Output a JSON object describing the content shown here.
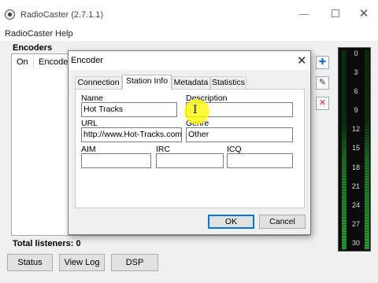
{
  "app": {
    "title": "RadioCaster (2.7.1.1)"
  },
  "window_controls": {
    "minimize": "—",
    "maximize": "",
    "close": "✕"
  },
  "menu": [
    "RadioCaster",
    "Help"
  ],
  "encoders": {
    "label": "Encoders",
    "columns": [
      "On",
      "Encoder"
    ],
    "total_listeners": "Total listeners: 0"
  },
  "side_icons": [
    "add-icon",
    "edit-icon",
    "delete-icon"
  ],
  "bottom_buttons": [
    "Status",
    "View Log",
    "DSP"
  ],
  "meter": {
    "scale": [
      "0",
      "3",
      "6",
      "9",
      "12",
      "15",
      "18",
      "21",
      "24",
      "27",
      "30"
    ],
    "colors": {
      "bright": "#2fc23b",
      "dim": "#0a3a12"
    }
  },
  "dialog": {
    "title": "Encoder",
    "close": "✕",
    "tabs": [
      "Connection",
      "Station Info",
      "Metadata",
      "Statistics"
    ],
    "active_tab": "Station Info",
    "fields": {
      "name": {
        "label": "Name",
        "value": "Hot Tracks"
      },
      "description": {
        "label": "Description",
        "value": ""
      },
      "url": {
        "label": "URL",
        "value": "http://www.Hot-Tracks.com"
      },
      "genre": {
        "label": "Genre",
        "value": "Other"
      },
      "aim": {
        "label": "AIM",
        "value": ""
      },
      "irc": {
        "label": "IRC",
        "value": ""
      },
      "icq": {
        "label": "ICQ",
        "value": ""
      }
    },
    "ok_label": "OK",
    "cancel_label": "Cancel"
  }
}
